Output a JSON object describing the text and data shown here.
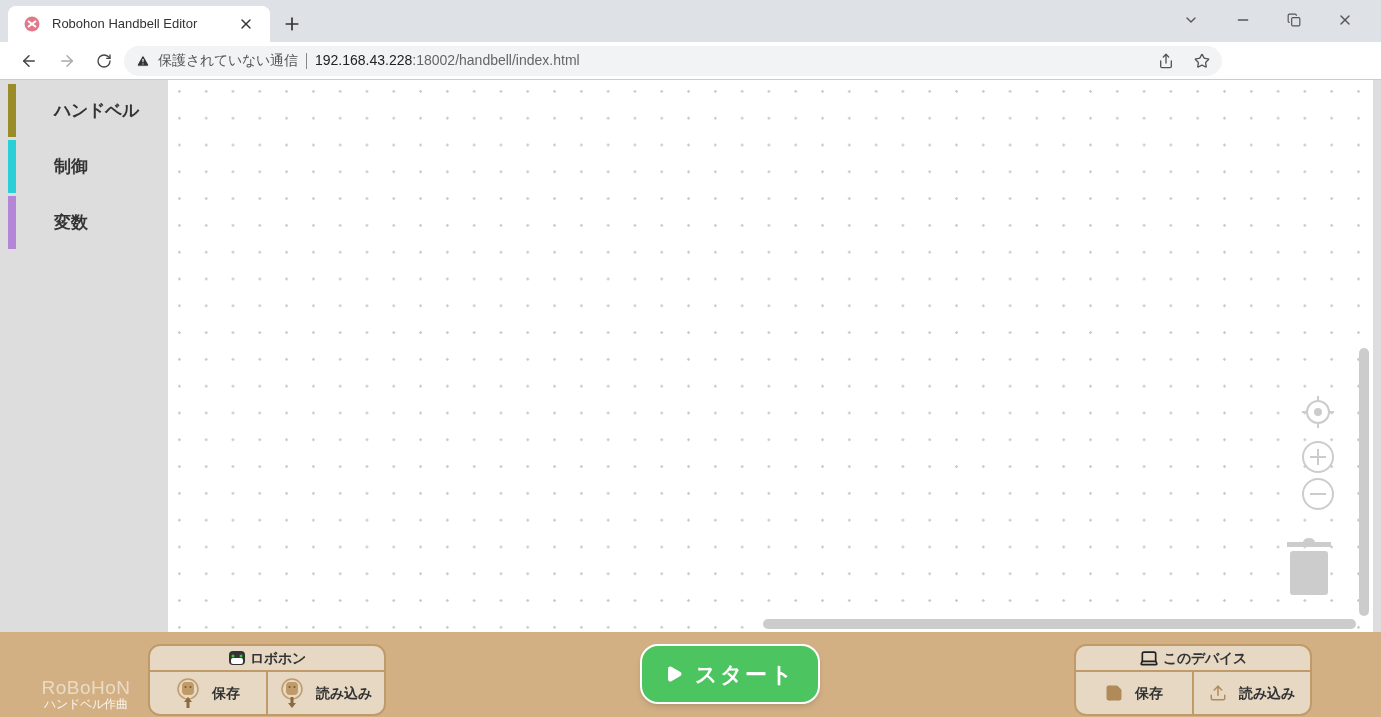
{
  "browser": {
    "tab": {
      "title": "Robohon Handbell Editor"
    },
    "address": {
      "security": "保護されていない通信",
      "host": "192.168.43.228",
      "path": ":18002/handbell/index.html"
    }
  },
  "categories": [
    {
      "label": "ハンドベル",
      "color": "#9b8c2a"
    },
    {
      "label": "制御",
      "color": "#2ad0d6"
    },
    {
      "label": "変数",
      "color": "#b486d8"
    }
  ],
  "footer": {
    "logo": "RoBoHoN",
    "logo_sub": "ハンドベル作曲",
    "robot_panel": {
      "title": "ロボホン",
      "save": "保存",
      "load": "読み込み"
    },
    "start": "スタート",
    "device_panel": {
      "title": "このデバイス",
      "save": "保存",
      "load": "読み込み"
    }
  }
}
